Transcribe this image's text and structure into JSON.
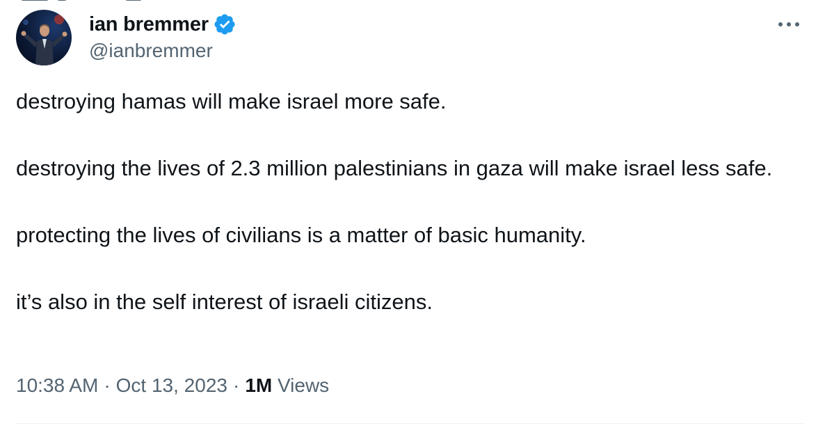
{
  "author": {
    "display_name": "ian bremmer",
    "handle": "@ianbremmer",
    "verified_icon": "verified-badge-icon",
    "avatar_icon": "profile-photo"
  },
  "tweet": {
    "paragraphs": [
      "destroying hamas will make israel more safe.",
      "destroying the lives of 2.3 million palestinians in gaza will make israel less safe.",
      "protecting the lives of civilians is a matter of basic humanity.",
      "it’s also in the self interest of israeli citizens."
    ]
  },
  "meta": {
    "time": "10:38 AM",
    "separator": "·",
    "date": "Oct 13, 2023",
    "views_count": "1M",
    "views_label": "Views"
  },
  "colors": {
    "text_primary": "#0f1419",
    "text_secondary": "#536471",
    "verified_blue": "#1d9bf0",
    "divider": "#eff3f4"
  }
}
